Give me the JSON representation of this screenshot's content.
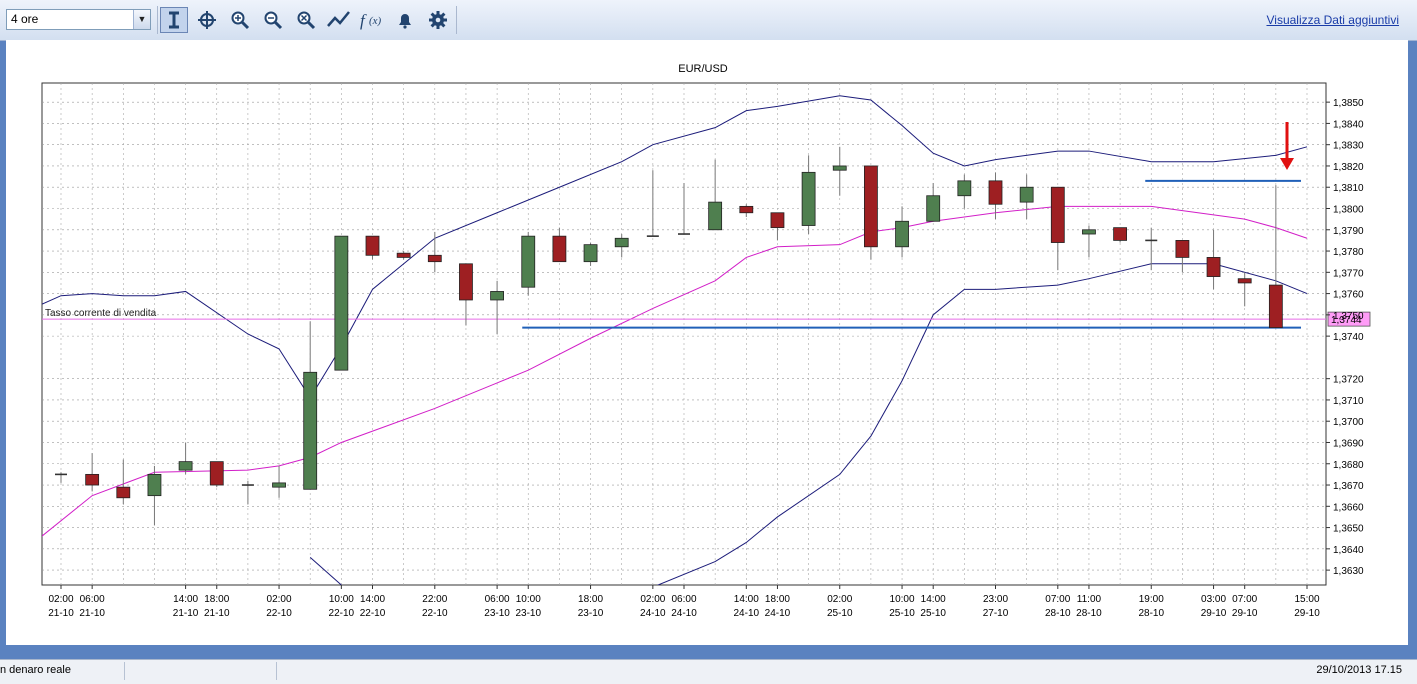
{
  "toolbar": {
    "timeframe": "4 ore",
    "extra_link": "Visualizza Dati aggiuntivi",
    "icons": [
      "cursor-icon",
      "crosshair-icon",
      "zoom-in-icon",
      "zoom-out-icon",
      "zoom-reset-icon",
      "line-draw-icon",
      "function-icon",
      "bell-icon",
      "gear-icon"
    ]
  },
  "status": {
    "left": "n denaro reale",
    "right": "29/10/2013 17.15"
  },
  "chart_data": {
    "type": "candlestick",
    "title": "EUR/USD",
    "ylim": [
      1.3623,
      1.3859
    ],
    "yticks": [
      "1,3850",
      "1,3840",
      "1,3830",
      "1,3820",
      "1,3810",
      "1,3800",
      "1,3790",
      "1,3780",
      "1,3770",
      "1,3760",
      "1,3750",
      "1,3740",
      "1,3720",
      "1,3710",
      "1,3700",
      "1,3690",
      "1,3680",
      "1,3670",
      "1,3660",
      "1,3650",
      "1,3640",
      "1,3630"
    ],
    "grid": true,
    "xlabels": [
      {
        "i": 0,
        "t": "02:00",
        "d": "21-10"
      },
      {
        "i": 1,
        "t": "06:00",
        "d": "21-10"
      },
      {
        "i": 4,
        "t": "14:00",
        "d": "21-10"
      },
      {
        "i": 5,
        "t": "18:00",
        "d": "21-10"
      },
      {
        "i": 7,
        "t": "02:00",
        "d": "22-10"
      },
      {
        "i": 9,
        "t": "10:00",
        "d": "22-10"
      },
      {
        "i": 10,
        "t": "14:00",
        "d": "22-10"
      },
      {
        "i": 12,
        "t": "22:00",
        "d": "22-10"
      },
      {
        "i": 14,
        "t": "06:00",
        "d": "23-10"
      },
      {
        "i": 15,
        "t": "10:00",
        "d": "23-10"
      },
      {
        "i": 17,
        "t": "18:00",
        "d": "23-10"
      },
      {
        "i": 19,
        "t": "02:00",
        "d": "24-10"
      },
      {
        "i": 20,
        "t": "06:00",
        "d": "24-10"
      },
      {
        "i": 22,
        "t": "14:00",
        "d": "24-10"
      },
      {
        "i": 23,
        "t": "18:00",
        "d": "24-10"
      },
      {
        "i": 25,
        "t": "02:00",
        "d": "25-10"
      },
      {
        "i": 27,
        "t": "10:00",
        "d": "25-10"
      },
      {
        "i": 28,
        "t": "14:00",
        "d": "25-10"
      },
      {
        "i": 30,
        "t": "23:00",
        "d": "27-10"
      },
      {
        "i": 32,
        "t": "07:00",
        "d": "28-10"
      },
      {
        "i": 33,
        "t": "11:00",
        "d": "28-10"
      },
      {
        "i": 35,
        "t": "19:00",
        "d": "28-10"
      },
      {
        "i": 37,
        "t": "03:00",
        "d": "29-10"
      },
      {
        "i": 38,
        "t": "07:00",
        "d": "29-10"
      },
      {
        "i": 40,
        "t": "15:00",
        "d": "29-10"
      }
    ],
    "candles": [
      {
        "o": 1.3675,
        "h": 1.3676,
        "l": 1.3671,
        "c": 1.3675
      },
      {
        "o": 1.3675,
        "h": 1.3685,
        "l": 1.3667,
        "c": 1.367
      },
      {
        "o": 1.3669,
        "h": 1.3682,
        "l": 1.3661,
        "c": 1.3664
      },
      {
        "o": 1.3665,
        "h": 1.3679,
        "l": 1.3651,
        "c": 1.3675
      },
      {
        "o": 1.3677,
        "h": 1.369,
        "l": 1.3675,
        "c": 1.3681
      },
      {
        "o": 1.3681,
        "h": 1.3681,
        "l": 1.3669,
        "c": 1.367
      },
      {
        "o": 1.367,
        "h": 1.3672,
        "l": 1.3661,
        "c": 1.367
      },
      {
        "o": 1.3669,
        "h": 1.3679,
        "l": 1.3664,
        "c": 1.3671
      },
      {
        "o": 1.3668,
        "h": 1.3747,
        "l": 1.3668,
        "c": 1.3723
      },
      {
        "o": 1.3724,
        "h": 1.3787,
        "l": 1.3724,
        "c": 1.3787
      },
      {
        "o": 1.3787,
        "h": 1.3787,
        "l": 1.3776,
        "c": 1.3778
      },
      {
        "o": 1.3779,
        "h": 1.378,
        "l": 1.3776,
        "c": 1.3777
      },
      {
        "o": 1.3778,
        "h": 1.3789,
        "l": 1.377,
        "c": 1.3775
      },
      {
        "o": 1.3774,
        "h": 1.3774,
        "l": 1.3745,
        "c": 1.3757
      },
      {
        "o": 1.3757,
        "h": 1.3766,
        "l": 1.3741,
        "c": 1.3761
      },
      {
        "o": 1.3763,
        "h": 1.3789,
        "l": 1.3759,
        "c": 1.3787
      },
      {
        "o": 1.3787,
        "h": 1.3791,
        "l": 1.3775,
        "c": 1.3775
      },
      {
        "o": 1.3775,
        "h": 1.3784,
        "l": 1.3773,
        "c": 1.3783
      },
      {
        "o": 1.3782,
        "h": 1.3788,
        "l": 1.3777,
        "c": 1.3786
      },
      {
        "o": 1.3787,
        "h": 1.3818,
        "l": 1.3787,
        "c": 1.3787
      },
      {
        "o": 1.3788,
        "h": 1.3812,
        "l": 1.3788,
        "c": 1.3788
      },
      {
        "o": 1.379,
        "h": 1.3823,
        "l": 1.379,
        "c": 1.3803
      },
      {
        "o": 1.3801,
        "h": 1.3802,
        "l": 1.3796,
        "c": 1.3798
      },
      {
        "o": 1.3798,
        "h": 1.3798,
        "l": 1.3785,
        "c": 1.3791
      },
      {
        "o": 1.3792,
        "h": 1.3825,
        "l": 1.3788,
        "c": 1.3817
      },
      {
        "o": 1.3818,
        "h": 1.3829,
        "l": 1.3806,
        "c": 1.382
      },
      {
        "o": 1.382,
        "h": 1.382,
        "l": 1.3776,
        "c": 1.3782
      },
      {
        "o": 1.3782,
        "h": 1.3801,
        "l": 1.3777,
        "c": 1.3794
      },
      {
        "o": 1.3794,
        "h": 1.3812,
        "l": 1.3794,
        "c": 1.3806
      },
      {
        "o": 1.3806,
        "h": 1.3816,
        "l": 1.38,
        "c": 1.3813
      },
      {
        "o": 1.3813,
        "h": 1.3817,
        "l": 1.3795,
        "c": 1.3802
      },
      {
        "o": 1.3803,
        "h": 1.3816,
        "l": 1.3795,
        "c": 1.381
      },
      {
        "o": 1.381,
        "h": 1.381,
        "l": 1.3771,
        "c": 1.3784
      },
      {
        "o": 1.3788,
        "h": 1.3792,
        "l": 1.3777,
        "c": 1.379
      },
      {
        "o": 1.3791,
        "h": 1.3791,
        "l": 1.3784,
        "c": 1.3785
      },
      {
        "o": 1.3785,
        "h": 1.3791,
        "l": 1.3771,
        "c": 1.3785
      },
      {
        "o": 1.3785,
        "h": 1.3785,
        "l": 1.377,
        "c": 1.3777
      },
      {
        "o": 1.3777,
        "h": 1.379,
        "l": 1.3762,
        "c": 1.3768
      },
      {
        "o": 1.3767,
        "h": 1.377,
        "l": 1.3754,
        "c": 1.3765
      },
      {
        "o": 1.3764,
        "h": 1.3811,
        "l": 1.3744,
        "c": 1.3744
      }
    ],
    "boll_upper": [
      [
        -1,
        1.3755
      ],
      [
        0,
        1.3759
      ],
      [
        1,
        1.376
      ],
      [
        2,
        1.3759
      ],
      [
        3,
        1.3759
      ],
      [
        4,
        1.3761
      ],
      [
        6,
        1.3741
      ],
      [
        7,
        1.3734
      ],
      [
        8,
        1.3711
      ],
      [
        9,
        1.3735
      ],
      [
        10,
        1.3762
      ],
      [
        12,
        1.3786
      ],
      [
        14,
        1.3798
      ],
      [
        16,
        1.381
      ],
      [
        18,
        1.3822
      ],
      [
        19,
        1.383
      ],
      [
        21,
        1.3838
      ],
      [
        22,
        1.3846
      ],
      [
        23,
        1.3848
      ],
      [
        25,
        1.3853
      ],
      [
        26,
        1.3851
      ],
      [
        27,
        1.3839
      ],
      [
        28,
        1.3826
      ],
      [
        29,
        1.382
      ],
      [
        30,
        1.3823
      ],
      [
        32,
        1.3827
      ],
      [
        33,
        1.3827
      ],
      [
        35,
        1.3822
      ],
      [
        37,
        1.3822
      ],
      [
        39,
        1.3825
      ],
      [
        40,
        1.3829
      ]
    ],
    "boll_middle": [
      [
        -1,
        1.3646
      ],
      [
        1,
        1.3665
      ],
      [
        3,
        1.3676
      ],
      [
        6,
        1.3677
      ],
      [
        7,
        1.3679
      ],
      [
        8,
        1.3683
      ],
      [
        9,
        1.369
      ],
      [
        12,
        1.3706
      ],
      [
        14,
        1.3718
      ],
      [
        15,
        1.3724
      ],
      [
        17,
        1.3739
      ],
      [
        19,
        1.3753
      ],
      [
        21,
        1.3766
      ],
      [
        22,
        1.3777
      ],
      [
        23,
        1.3782
      ],
      [
        25,
        1.3783
      ],
      [
        26,
        1.3789
      ],
      [
        27,
        1.3791
      ],
      [
        28,
        1.3794
      ],
      [
        30,
        1.3798
      ],
      [
        32,
        1.3801
      ],
      [
        35,
        1.3801
      ],
      [
        36,
        1.3799
      ],
      [
        38,
        1.3795
      ],
      [
        39,
        1.3791
      ],
      [
        40,
        1.3786
      ]
    ],
    "boll_lower": [
      [
        8,
        1.3636
      ],
      [
        9,
        1.3623
      ],
      [
        19,
        1.3622
      ],
      [
        21,
        1.3634
      ],
      [
        22,
        1.3643
      ],
      [
        23,
        1.3655
      ],
      [
        25,
        1.3675
      ],
      [
        26,
        1.3693
      ],
      [
        27,
        1.3719
      ],
      [
        28,
        1.375
      ],
      [
        29,
        1.3762
      ],
      [
        30,
        1.3762
      ],
      [
        32,
        1.3764
      ],
      [
        33,
        1.3767
      ],
      [
        35,
        1.3774
      ],
      [
        37,
        1.3774
      ],
      [
        39,
        1.3766
      ],
      [
        40,
        1.376
      ]
    ],
    "hlines": [
      {
        "label": "Tasso corrente di vendita",
        "value": 1.3748
      },
      {
        "value": 1.3813,
        "from": 35,
        "to": 40
      },
      {
        "value": 1.3744,
        "from": 15,
        "to": 40
      }
    ],
    "price_tag": "1,3744"
  }
}
